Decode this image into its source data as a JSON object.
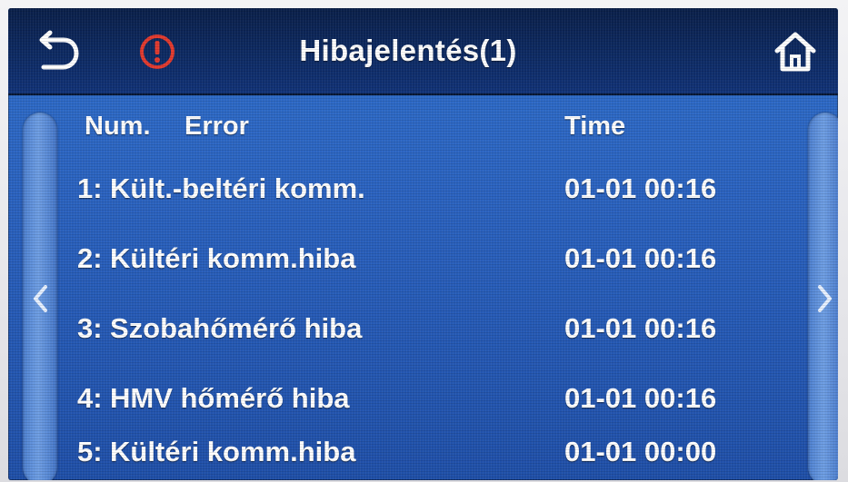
{
  "header": {
    "title": "Hibajelentés(1)",
    "back_icon": "back-arrow-icon",
    "alarm_icon": "alarm-icon",
    "home_icon": "home-icon"
  },
  "colors": {
    "header_bg": "#0d2a63",
    "screen_bg": "#2a62bf",
    "alarm": "#e23a2e",
    "text": "#ffffff"
  },
  "table": {
    "columns": {
      "num": "Num.",
      "error": "Error",
      "time": "Time"
    },
    "rows": [
      {
        "num": "1:",
        "error": "Kült.-beltéri komm.",
        "time": "01-01 00:16"
      },
      {
        "num": "2:",
        "error": "Kültéri komm.hiba",
        "time": "01-01 00:16"
      },
      {
        "num": "3:",
        "error": "Szobahőmérő hiba",
        "time": "01-01 00:16"
      },
      {
        "num": "4:",
        "error": "HMV hőmérő hiba",
        "time": "01-01 00:16"
      },
      {
        "num": "5:",
        "error": "Kültéri komm.hiba",
        "time": "01-01 00:00"
      }
    ]
  },
  "nav": {
    "prev_icon": "chevron-left-icon",
    "next_icon": "chevron-right-icon"
  }
}
